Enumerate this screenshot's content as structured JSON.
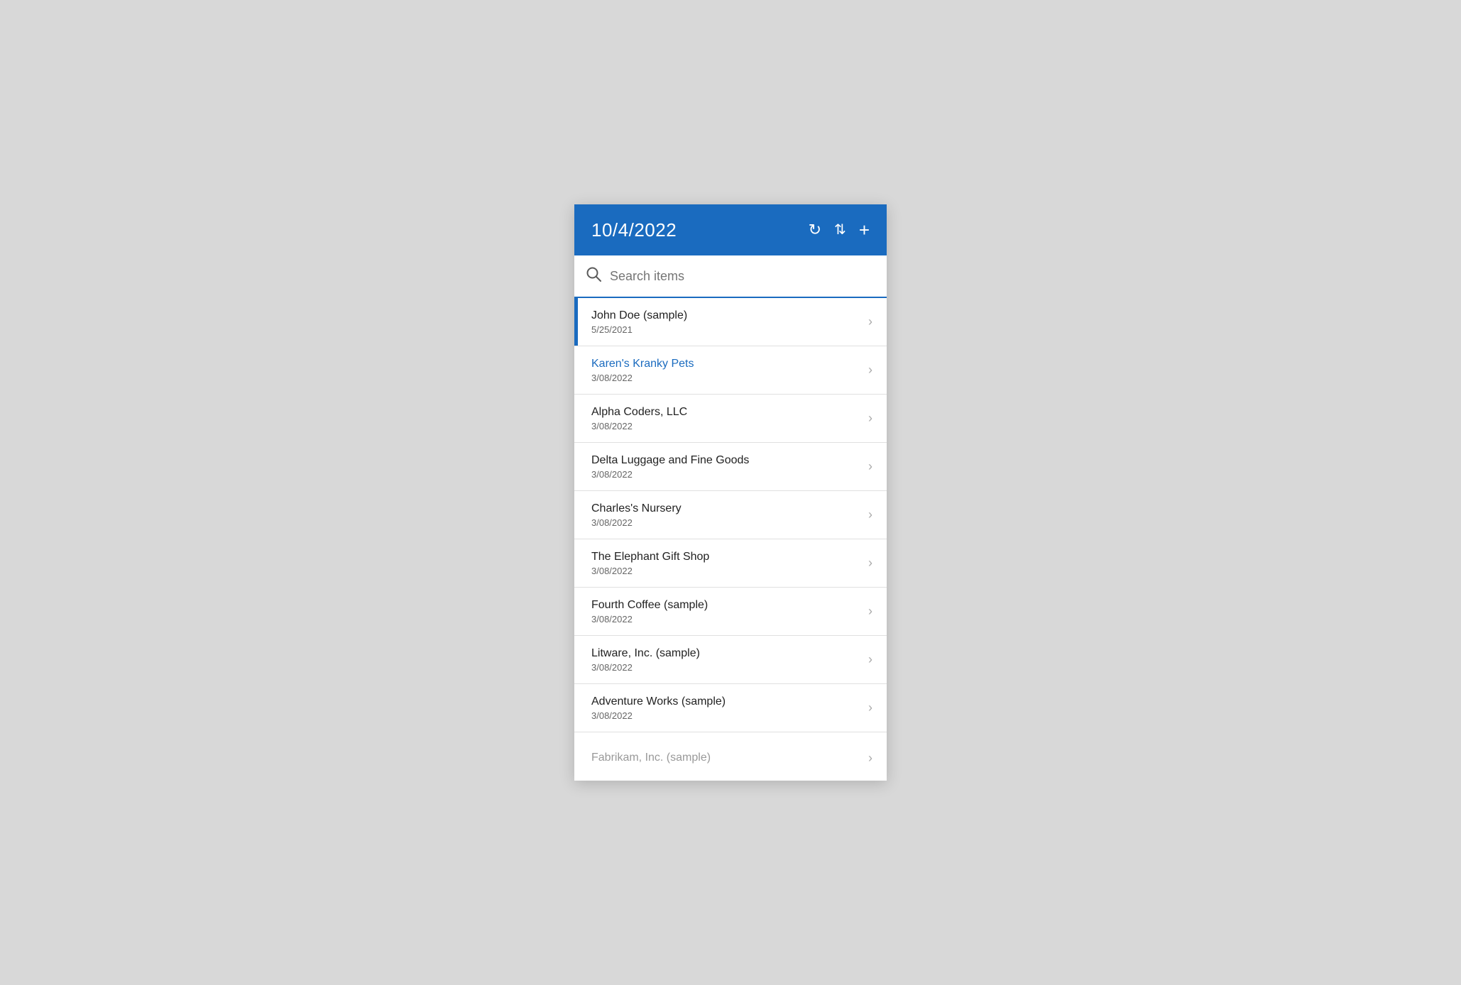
{
  "header": {
    "title": "10/4/2022",
    "refresh_icon": "↻",
    "sort_icon": "⇅",
    "add_icon": "+"
  },
  "search": {
    "placeholder": "Search items"
  },
  "items": [
    {
      "name": "John Doe (sample)",
      "date": "5/25/2021",
      "selected": true,
      "link": false
    },
    {
      "name": "Karen's Kranky Pets",
      "date": "3/08/2022",
      "selected": false,
      "link": true
    },
    {
      "name": "Alpha Coders, LLC",
      "date": "3/08/2022",
      "selected": false,
      "link": false
    },
    {
      "name": "Delta Luggage and Fine Goods",
      "date": "3/08/2022",
      "selected": false,
      "link": false
    },
    {
      "name": "Charles's Nursery",
      "date": "3/08/2022",
      "selected": false,
      "link": false
    },
    {
      "name": "The Elephant Gift Shop",
      "date": "3/08/2022",
      "selected": false,
      "link": false
    },
    {
      "name": "Fourth Coffee (sample)",
      "date": "3/08/2022",
      "selected": false,
      "link": false
    },
    {
      "name": "Litware, Inc. (sample)",
      "date": "3/08/2022",
      "selected": false,
      "link": false
    },
    {
      "name": "Adventure Works (sample)",
      "date": "3/08/2022",
      "selected": false,
      "link": false
    },
    {
      "name": "Fabrikam, Inc. (sample)",
      "date": "",
      "selected": false,
      "link": false,
      "partial": true
    }
  ],
  "colors": {
    "accent": "#1a6bbf",
    "link": "#1a6bbf",
    "selected_bar": "#1a6bbf"
  }
}
